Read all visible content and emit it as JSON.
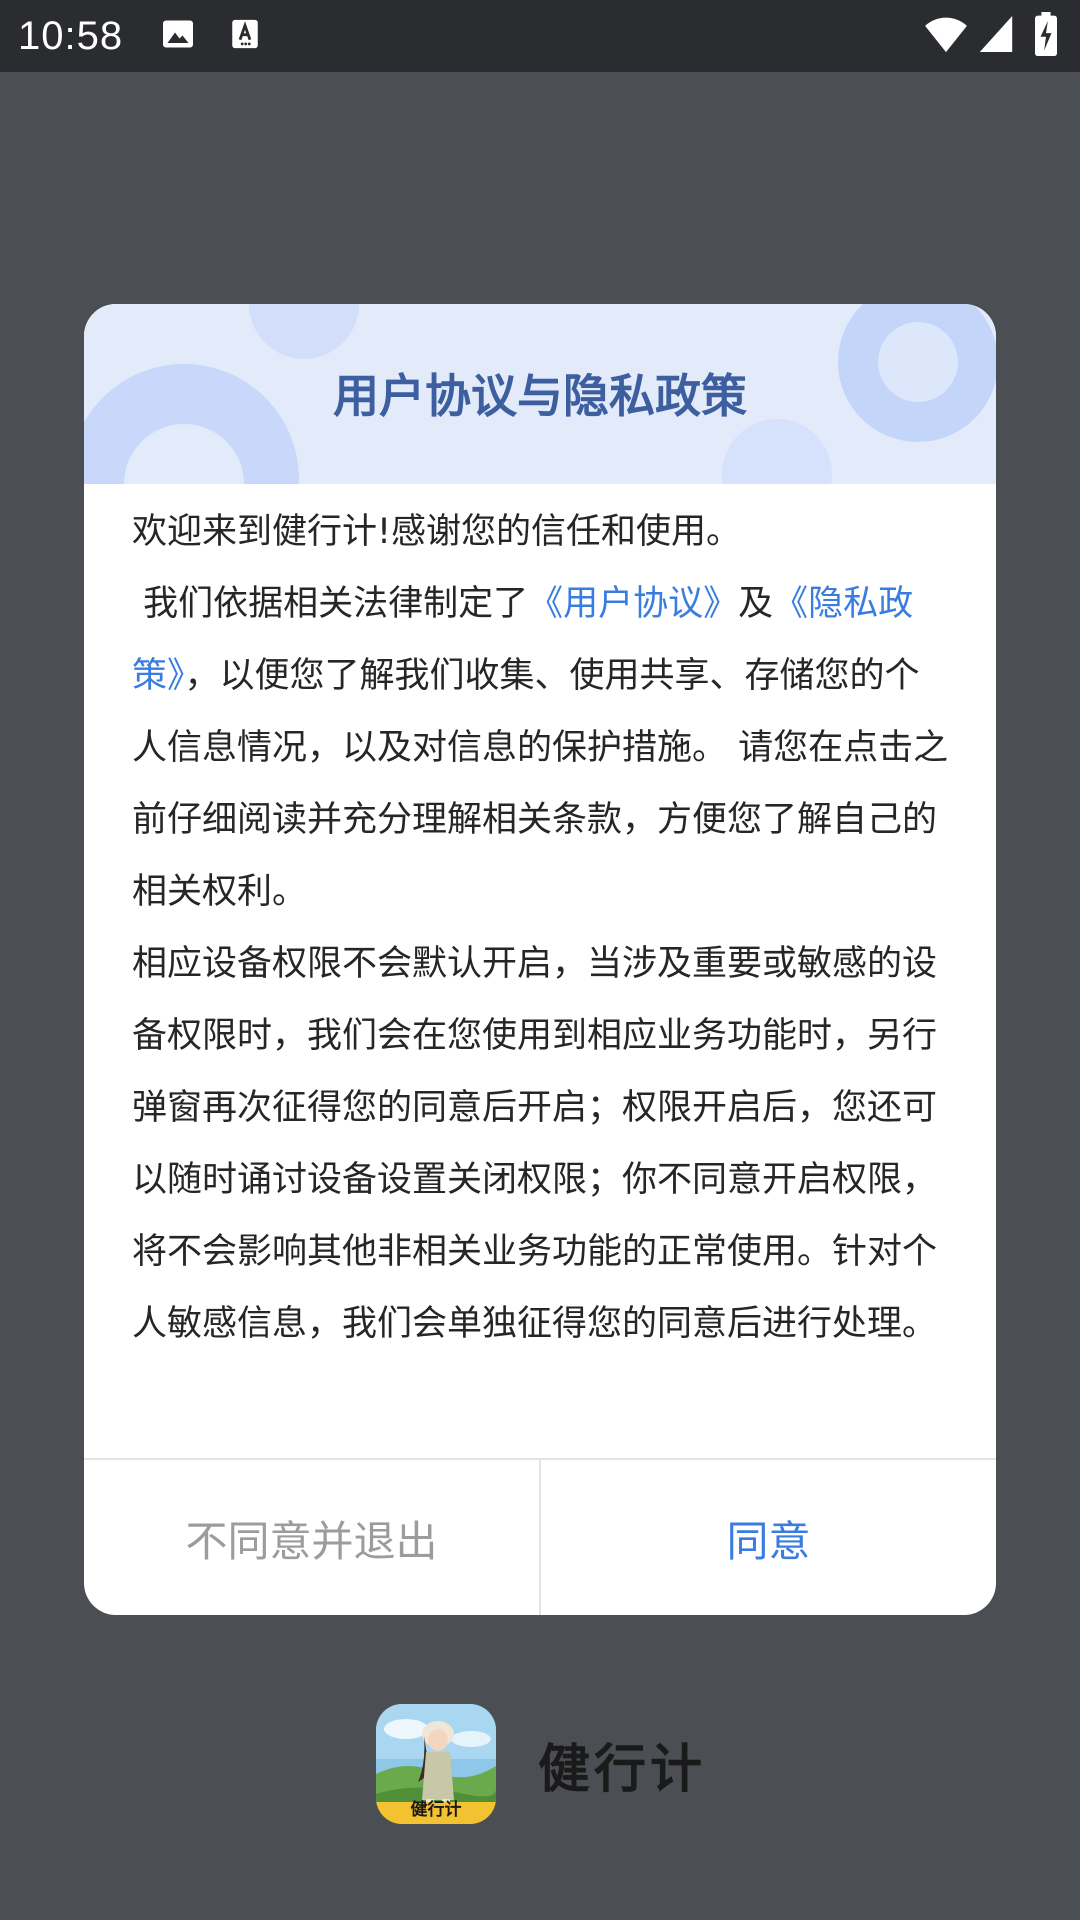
{
  "status_bar": {
    "time": "10:58",
    "icons": [
      "image-icon",
      "font-download-icon",
      "wifi-icon",
      "signal-icon",
      "battery-charging-icon"
    ]
  },
  "dialog": {
    "title": "用户协议与隐私政策",
    "welcome": "欢迎来到健行计!感谢您的信任和使用。",
    "para1_prefix": " 我们依据相关法律制定了",
    "user_agreement_link": "《用户协议》",
    "conjunction": "及",
    "privacy_policy_link": "《隐私政策》",
    "para1_suffix": "，以便您了解我们收集、使用共享、存储您的个人信息情况，以及对信息的保护措施。 请您在点击之前仔细阅读并充分理解相关条款，方便您了解自己的相关权利。",
    "para2": "相应设备权限不会默认开启，当涉及重要或敏感的设备权限时，我们会在您使用到相应业务功能时，另行弹窗再次征得您的同意后开启；权限开启后，您还可以随时诵讨设备设置关闭权限；你不同意开启权限，将不会影响其他非相关业务功能的正常使用。针对个人敏感信息，我们会单独征得您的同意后进行处理。",
    "decline_label": "不同意并退出",
    "accept_label": "同意",
    "colors": {
      "title": "#3d5f9f",
      "link": "#3a7de0",
      "header_bg": "#e3ebfb",
      "decline": "#9c9c9c"
    }
  },
  "app": {
    "name": "健行计",
    "icon_label": "健行计"
  }
}
